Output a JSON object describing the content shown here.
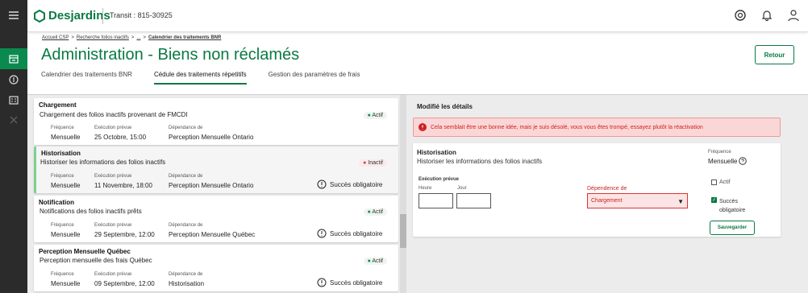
{
  "header": {
    "logo": "Desjardins",
    "transit": "Transit : 815-30925"
  },
  "breadcrumb": {
    "item1": "Accueil CSP",
    "sep": ">",
    "item2": "Recherche folios inactifs",
    "item3": "...",
    "current": "Calendrier des traitements BNR"
  },
  "page": {
    "title": "Administration - Biens non réclamés",
    "back": "Retour"
  },
  "tabs": [
    {
      "label": "Calendrier des traitements BNR"
    },
    {
      "label": "Cédule des traitements répetitifs"
    },
    {
      "label": "Gestion des paramètres de frais"
    }
  ],
  "labels": {
    "freq": "Fréquence",
    "exec": "Exécution prévue",
    "dep": "Dépendance de",
    "succ": "Succès obligatoire"
  },
  "cards": [
    {
      "title": "Chargement",
      "desc": "Chargement des folios inactifs provenant de FMCDI",
      "status": "Actif",
      "freq": "Mensuelle",
      "exec": "25 Octobre, 15:00",
      "dep": "Perception Mensuelle Ontario"
    },
    {
      "title": "Historisation",
      "desc": "Historiser les informations des folios inactifs",
      "status": "Inactif",
      "freq": "Mensuelle",
      "exec": "11 Novembre, 18:00",
      "dep": "Perception Mensuelle Ontario"
    },
    {
      "title": "Notification",
      "desc": "Notifications des folios inactifs prêts",
      "status": "Actif",
      "freq": "Mensuelle",
      "exec": "29 Septembre, 12:00",
      "dep": "Perception Mensuelle Québec"
    },
    {
      "title": "Perception Mensuelle Québec",
      "desc": "Perception mensuelle des frais Québec",
      "status": "Actif",
      "freq": "Mensuelle",
      "exec": "09 Septembre, 12:00",
      "dep": "Historisation"
    }
  ],
  "detail": {
    "heading": "Modifié les détails",
    "alert": "Cela semblait être une bonne idée, mais je suis désolé, vous vous êtes trompé, essayez plutôt la réactivation",
    "title": "Historisation",
    "desc": "Historiser les informations des folios inactifs",
    "freq_label": "Fréquence",
    "freq_value": "Mensuelle",
    "exec_label": "Exécution prévue",
    "hour_label": "Heure",
    "day_label": "Jour",
    "dep_label": "Dépendence de",
    "dep_value": "Chargement",
    "active_label": "Actif",
    "succ_label": "Succès obligatoire",
    "save": "Sauvegarder"
  }
}
